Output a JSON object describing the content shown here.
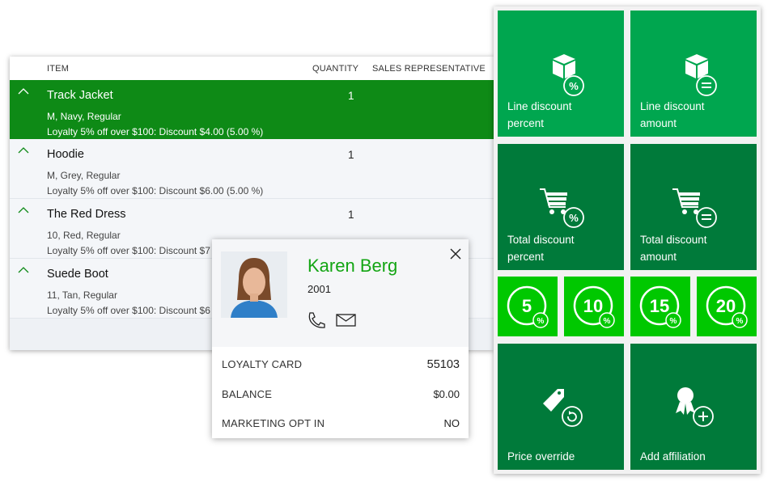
{
  "colors": {
    "selected_row": "#0e8a16",
    "tile_light": "#00a64f",
    "tile_dark": "#007a3a",
    "tile_bright": "#00c800",
    "name_green": "#13a513"
  },
  "table": {
    "headers": {
      "item": "ITEM",
      "quantity": "QUANTITY",
      "sales_rep": "SALES REPRESENTATIVE"
    },
    "rows": [
      {
        "name": "Track Jacket",
        "qty": "1",
        "variant": "M, Navy, Regular",
        "discount": "Loyalty 5% off over $100: Discount $4.00 (5.00 %)",
        "selected": true
      },
      {
        "name": "Hoodie",
        "qty": "1",
        "variant": "M, Grey, Regular",
        "discount": "Loyalty 5% off over $100: Discount $6.00 (5.00 %)",
        "selected": false
      },
      {
        "name": "The Red Dress",
        "qty": "1",
        "variant": "10, Red, Regular",
        "discount": "Loyalty 5% off over $100: Discount $7",
        "selected": false
      },
      {
        "name": "Suede Boot",
        "qty": "",
        "variant": "11, Tan, Regular",
        "discount": "Loyalty 5% off over $100: Discount $6",
        "selected": false
      }
    ]
  },
  "tiles": {
    "line_discount_percent": {
      "label1": "Line discount",
      "label2": "percent",
      "icon": "box-percent-icon"
    },
    "line_discount_amount": {
      "label1": "Line discount",
      "label2": "amount",
      "icon": "box-equals-icon"
    },
    "total_discount_percent": {
      "label1": "Total discount",
      "label2": "percent",
      "icon": "cart-percent-icon"
    },
    "total_discount_amount": {
      "label1": "Total discount",
      "label2": "amount",
      "icon": "cart-equals-icon"
    },
    "quick": [
      {
        "value": "5"
      },
      {
        "value": "10"
      },
      {
        "value": "15"
      },
      {
        "value": "20"
      }
    ],
    "price_override": {
      "label": "Price override",
      "icon": "tag-refresh-icon"
    },
    "add_affiliation": {
      "label": "Add affiliation",
      "icon": "ribbon-plus-icon"
    }
  },
  "customer": {
    "name": "Karen Berg",
    "id": "2001",
    "loyalty_label": "LOYALTY CARD",
    "loyalty_value": "55103",
    "balance_label": "BALANCE",
    "balance_value": "$0.00",
    "opt_in_label": "MARKETING OPT IN",
    "opt_in_value": "NO"
  }
}
